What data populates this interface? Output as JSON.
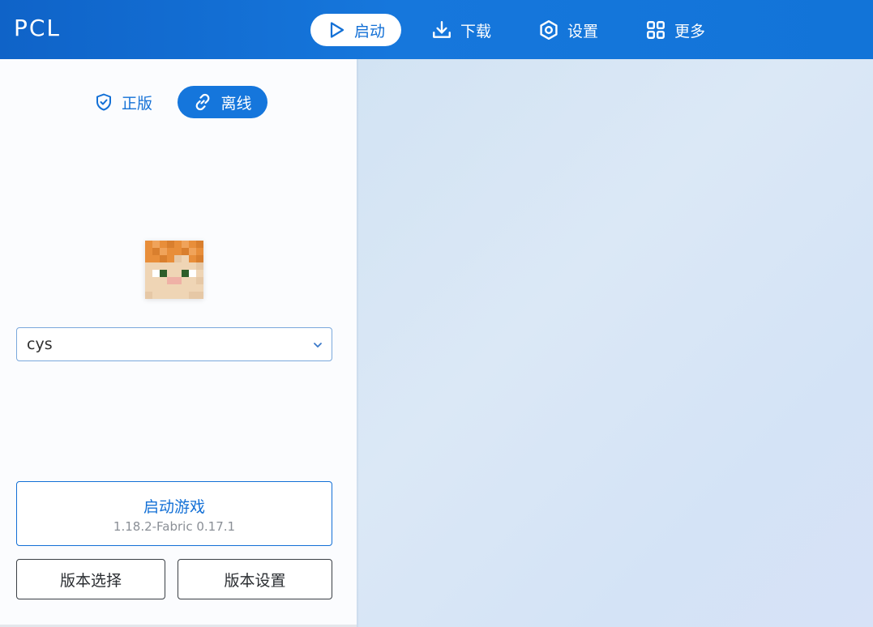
{
  "app": {
    "logo": "PCL"
  },
  "nav": [
    {
      "label": "启动",
      "icon": "play-icon",
      "active": true
    },
    {
      "label": "下载",
      "icon": "download-icon",
      "active": false
    },
    {
      "label": "设置",
      "icon": "settings-icon",
      "active": false
    },
    {
      "label": "更多",
      "icon": "grid-icon",
      "active": false
    }
  ],
  "account_tabs": {
    "official": {
      "label": "正版",
      "icon": "shield-check-icon"
    },
    "offline": {
      "label": "离线",
      "icon": "link-icon",
      "active": true
    }
  },
  "player": {
    "avatar": "player-skin-head",
    "username": "cys"
  },
  "launch": {
    "title": "启动游戏",
    "version": "1.18.2-Fabric 0.17.1"
  },
  "buttons": {
    "version_select": "版本选择",
    "version_settings": "版本设置"
  },
  "colors": {
    "accent": "#1370d6",
    "titlebar": "#1677dc",
    "hair": "#e88e3a",
    "skin": "#efd5b5",
    "eye": "#2e5e2a",
    "nose": "#efb1a6"
  }
}
